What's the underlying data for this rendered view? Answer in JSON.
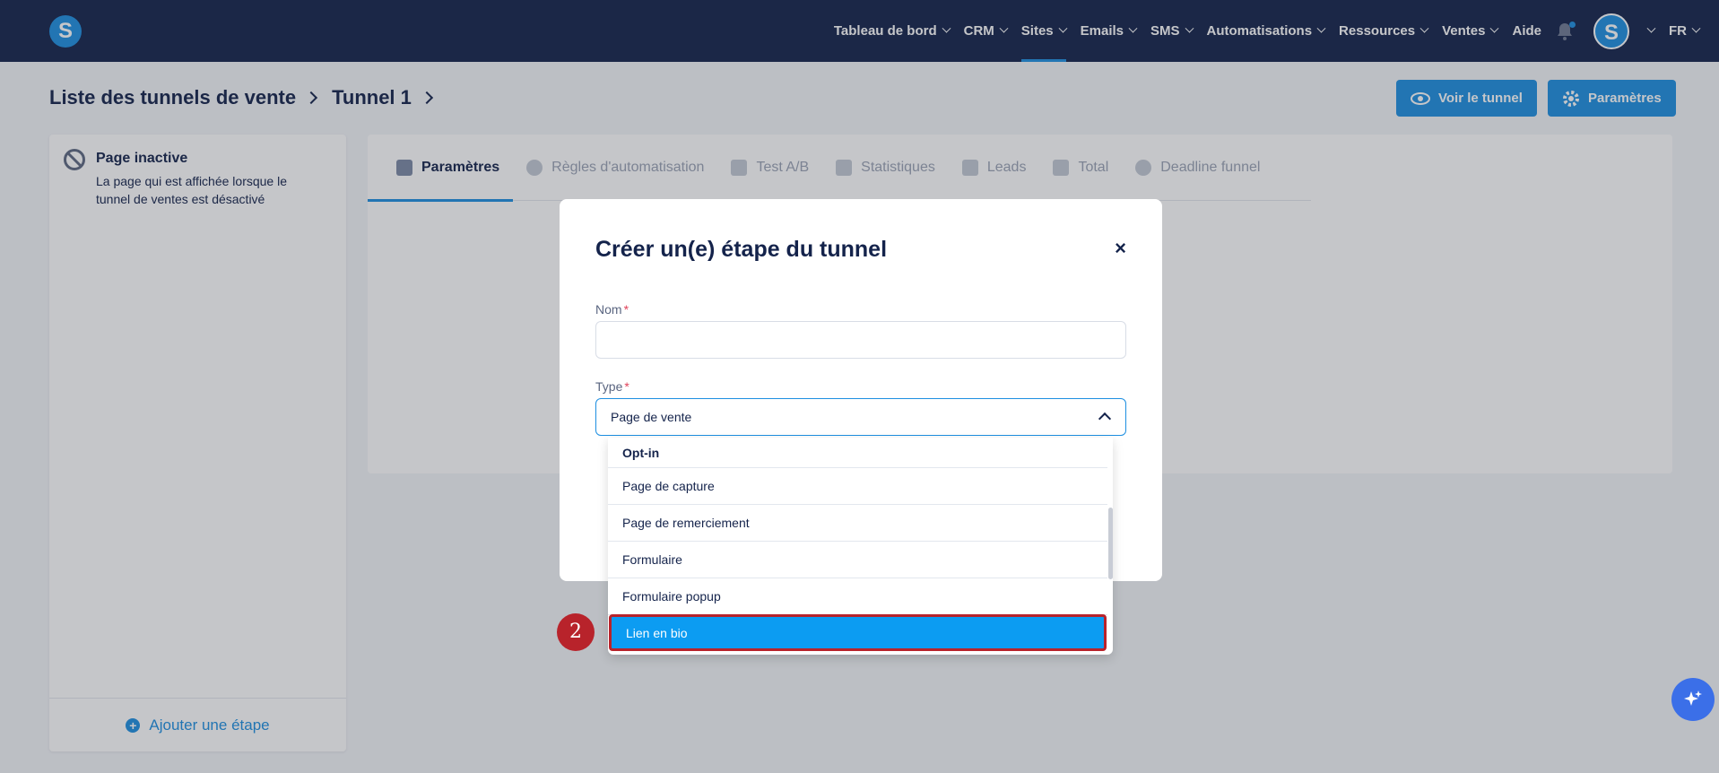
{
  "nav": {
    "logo": "S",
    "items": [
      {
        "label": "Tableau de bord",
        "active": false
      },
      {
        "label": "CRM",
        "active": false
      },
      {
        "label": "Sites",
        "active": true
      },
      {
        "label": "Emails",
        "active": false
      },
      {
        "label": "SMS",
        "active": false
      },
      {
        "label": "Automatisations",
        "active": false
      },
      {
        "label": "Ressources",
        "active": false
      },
      {
        "label": "Ventes",
        "active": false
      }
    ],
    "help": "Aide",
    "avatar": "S",
    "language": "FR"
  },
  "breadcrumb": {
    "root": "Liste des tunnels de vente",
    "current": "Tunnel 1"
  },
  "actions": {
    "view_tunnel": "Voir le tunnel",
    "settings": "Paramètres"
  },
  "left_panel": {
    "page_inactive_title": "Page inactive",
    "page_inactive_desc": "La page qui est affichée lorsque le tunnel de ventes est désactivé",
    "add_step": "Ajouter une étape"
  },
  "tabs": [
    {
      "label": "Paramètres",
      "icon": "sliders-icon",
      "active": true
    },
    {
      "label": "Règles d'automatisation",
      "icon": "bolt-icon",
      "active": false
    },
    {
      "label": "Test A/B",
      "icon": "split-icon",
      "active": false
    },
    {
      "label": "Statistiques",
      "icon": "chart-icon",
      "active": false
    },
    {
      "label": "Leads",
      "icon": "users-icon",
      "active": false
    },
    {
      "label": "Total",
      "icon": "dollar-icon",
      "active": false
    },
    {
      "label": "Deadline funnel",
      "icon": "clock-icon",
      "active": false
    }
  ],
  "modal": {
    "title": "Créer un(e) étape du tunnel",
    "close": "×",
    "name_label": "Nom",
    "name_value": "",
    "type_label": "Type",
    "type_value": "Page de vente",
    "required_mark": "*"
  },
  "dropdown": {
    "items": [
      {
        "label": "Opt-in",
        "group": true
      },
      {
        "label": "Page de capture"
      },
      {
        "label": "Page de remerciement"
      },
      {
        "label": "Formulaire"
      },
      {
        "label": "Formulaire popup"
      },
      {
        "label": "Lien en bio",
        "selected": true
      }
    ]
  },
  "step_badge": "2",
  "colors": {
    "nav_bg": "#14234b",
    "accent": "#1e8fe1",
    "highlight": "#0c9cf2",
    "badge": "#b8232b"
  }
}
